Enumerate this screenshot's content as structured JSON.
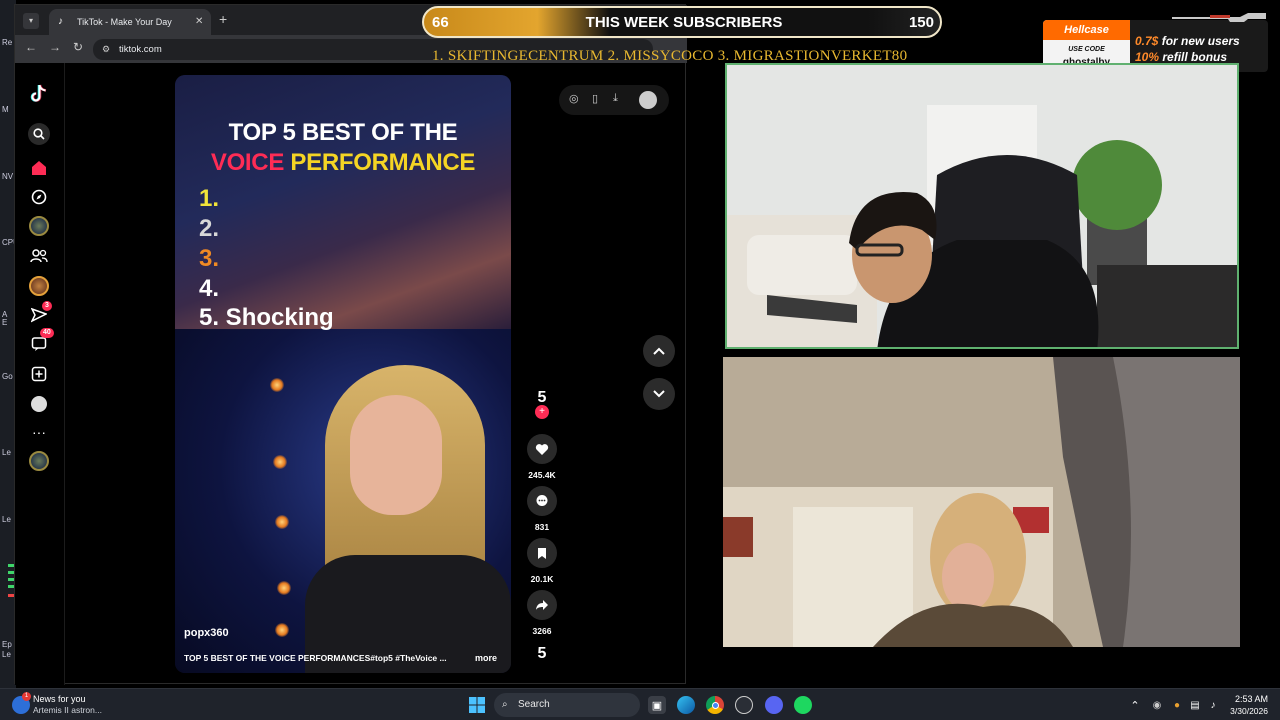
{
  "browser": {
    "tab_title": "TikTok - Make Your Day",
    "url": "tiktok.com"
  },
  "tiktok": {
    "sidebar_badges": {
      "inbox": "3",
      "messages": "40"
    },
    "video": {
      "title_line1": "TOP 5 BEST OF THE",
      "title_word_red": "VOICE",
      "title_word_yellow": "PERFORMANCE",
      "list": [
        "1.",
        "2.",
        "3.",
        "4.",
        "5. Shocking"
      ],
      "username": "popx360",
      "description": "TOP 5 BEST OF THE VOICE PERFORMANCES#top5 #TheVoice ...",
      "more_label": "more"
    },
    "actions": {
      "profile_count": "5",
      "likes": "245.4K",
      "comments": "831",
      "saves": "20.1K",
      "shares": "3266",
      "bottom_count": "5"
    }
  },
  "overlay": {
    "sub_left": "66",
    "sub_title": "THIS WEEK SUBSCRIBERS",
    "sub_right": "150",
    "ticker": "1. SKIFTINGECENTRUM  2. MISSYCOCO  3. MIGRASTIONVERKET80",
    "ad": {
      "logo": "Hellcase",
      "use_code_label": "USE CODE",
      "code": "ghostalby",
      "line1_amount": "0.7$",
      "line1_text": "for new users",
      "line2_amount": "10%",
      "line2_text": "refill bonus"
    }
  },
  "desktop": {
    "left_labels": [
      "Re",
      "M",
      "NV",
      "CPU",
      "A",
      "E",
      "Go",
      "Le",
      "Le",
      "Ep",
      "Le"
    ]
  },
  "taskbar": {
    "news_title": "News for you",
    "news_sub": "Artemis II astron...",
    "search_placeholder": "Search",
    "time": "2:53 AM",
    "date": "3/30/2026"
  },
  "colors": {
    "tiktok_red": "#fe2c55",
    "title_red": "#fe2c55",
    "title_yellow": "#f5d524",
    "num1": "#f1e43a",
    "num3": "#f08a24",
    "cam_border": "#5fb06f",
    "banner_gold": "#e3a52e"
  }
}
